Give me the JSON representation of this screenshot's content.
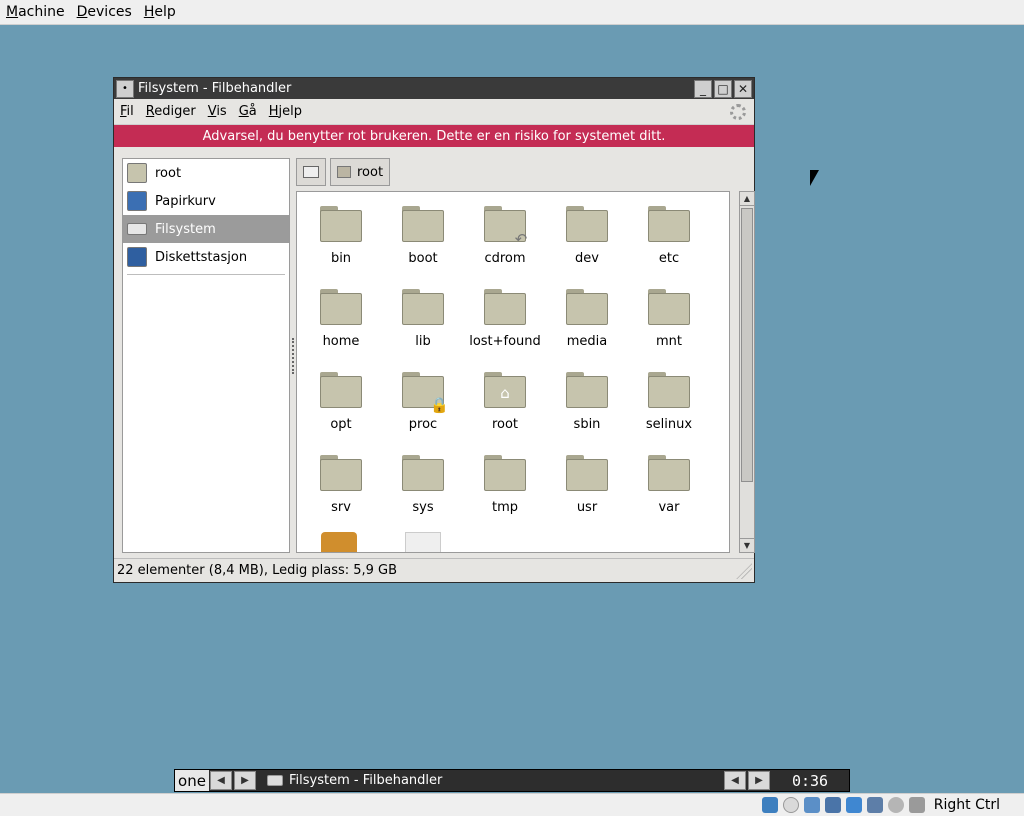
{
  "host_menubar": {
    "items": [
      {
        "label": "Machine"
      },
      {
        "label": "Devices"
      },
      {
        "label": "Help"
      }
    ]
  },
  "window": {
    "title": "Filsystem - Filbehandler",
    "menubar": [
      {
        "label": "Fil"
      },
      {
        "label": "Rediger"
      },
      {
        "label": "Vis"
      },
      {
        "label": "Gå"
      },
      {
        "label": "Hjelp"
      }
    ],
    "warning": "Advarsel, du benytter rot brukeren. Dette er en risiko for systemet ditt."
  },
  "sidebar": {
    "items": [
      {
        "label": "root",
        "icon": "home-folder-icon"
      },
      {
        "label": "Papirkurv",
        "icon": "trash-icon"
      },
      {
        "label": "Filsystem",
        "icon": "drive-icon",
        "selected": true
      },
      {
        "label": "Diskettstasjon",
        "icon": "floppy-icon"
      }
    ]
  },
  "pathbar": {
    "root_label": "root"
  },
  "files": [
    {
      "label": "bin"
    },
    {
      "label": "boot"
    },
    {
      "label": "cdrom",
      "emblem": "symlink-icon"
    },
    {
      "label": "dev"
    },
    {
      "label": "etc"
    },
    {
      "label": "home"
    },
    {
      "label": "lib"
    },
    {
      "label": "lost+found"
    },
    {
      "label": "media"
    },
    {
      "label": "mnt"
    },
    {
      "label": "opt"
    },
    {
      "label": "proc",
      "emblem": "lock-icon"
    },
    {
      "label": "root",
      "emblem": "home-icon"
    },
    {
      "label": "sbin"
    },
    {
      "label": "selinux"
    },
    {
      "label": "srv"
    },
    {
      "label": "sys"
    },
    {
      "label": "tmp"
    },
    {
      "label": "usr"
    },
    {
      "label": "var"
    }
  ],
  "statusbar": {
    "text": "22 elementer (8,4 MB), Ledig plass: 5,9 GB"
  },
  "taskbar": {
    "desktop_name": "one",
    "task_title": "Filsystem - Filbehandler",
    "clock": "0:36"
  },
  "host_statusbar": {
    "host_key": "Right Ctrl"
  },
  "colors": {
    "desktop": "#6a9bb3",
    "warning_bg": "#c42c54",
    "folder": "#c6c4ad"
  }
}
